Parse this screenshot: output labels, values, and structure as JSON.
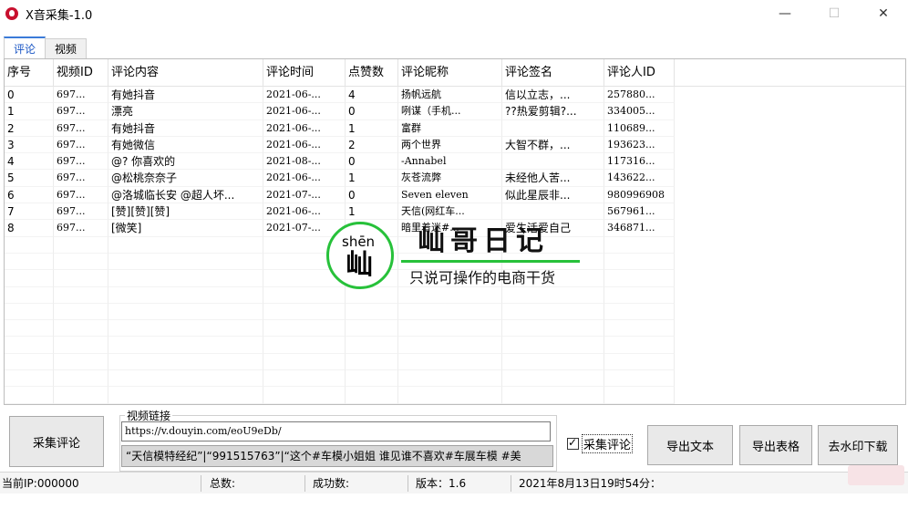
{
  "window": {
    "title": "X音采集-1.0",
    "minimize": "—",
    "maximize": "☐",
    "close": "✕"
  },
  "tabs": [
    {
      "label": "评论",
      "active": true
    },
    {
      "label": "视频",
      "active": false
    }
  ],
  "table": {
    "columns": [
      "序号",
      "视频ID",
      "评论内容",
      "评论时间",
      "点赞数",
      "评论昵称",
      "评论签名",
      "评论人ID"
    ],
    "rows": [
      [
        "0",
        "697...",
        "有她抖音",
        "2021-06-...",
        "4",
        "扬帆远航",
        "信以立志，...",
        "257880..."
      ],
      [
        "1",
        "697...",
        "漂亮",
        "2021-06-...",
        "0",
        "咧谋（手机...",
        "??热爱剪辑?...",
        "334005..."
      ],
      [
        "2",
        "697...",
        "有她抖音",
        "2021-06-...",
        "1",
        "富群",
        "",
        "110689..."
      ],
      [
        "3",
        "697...",
        "有她微信",
        "2021-06-...",
        "2",
        "两个世界",
        "大智不群，...",
        "193623..."
      ],
      [
        "4",
        "697...",
        "@? 你喜欢的",
        "2021-08-...",
        "0",
        "-Annabel",
        "",
        "117316..."
      ],
      [
        "5",
        "697...",
        "@松桃奈奈子",
        "2021-06-...",
        "1",
        "灰苍流弊",
        "未经他人苦...",
        "143622..."
      ],
      [
        "6",
        "697...",
        "@洛城临长安 @超人坏...",
        "2021-07-...",
        "0",
        "Seven eleven",
        "似此星辰非...",
        "980996908"
      ],
      [
        "7",
        "697...",
        "[赞][赞][赞]",
        "2021-06-...",
        "1",
        "天信(网红车...",
        "",
        "567961..."
      ],
      [
        "8",
        "697...",
        "[微笑]",
        "2021-07-...",
        "0",
        "暗里着迷#...",
        "爱生活爱自己",
        "346871..."
      ]
    ]
  },
  "watermark": {
    "pinyin": "shēn",
    "char": "屾",
    "title": "屾哥日记",
    "subtitle": "只说可操作的电商干货"
  },
  "controls": {
    "collect_button": "采集评论",
    "link_label": "视频链接",
    "link_value": "https://v.douyin.com/eoU9eDb/",
    "tags_text": "“天信模特经纪”|“991515763”|“这个#车模小姐姐 谁见谁不喜欢#车展车模 #美",
    "checkbox_label": "采集评论",
    "checkbox_checked": true,
    "export_text_button": "导出文本",
    "export_table_button": "导出表格",
    "download_button": "去水印下载"
  },
  "status": {
    "ip": "当前IP:000000",
    "total": "总数:",
    "success": "成功数:",
    "version": "版本：1.6",
    "datetime": "2021年8月13日19时54分："
  }
}
